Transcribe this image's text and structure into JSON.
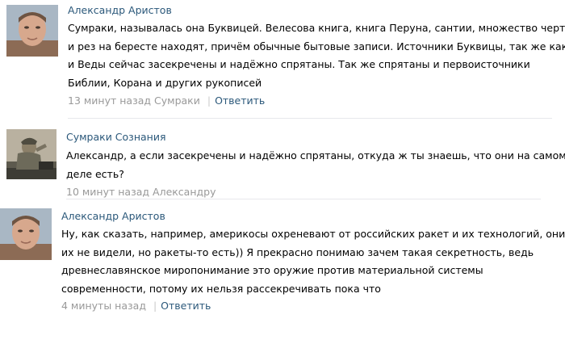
{
  "comments": [
    {
      "author": "Александр Аристов",
      "text_lines": [
        "Сумраки, называлась она Буквицей. Велесова книга, книга Перуна, сантии, множество черт",
        "и рез на бересте находят, причём обычные бытовые записи. Источники Буквицы, так же как",
        "и Веды сейчас засекречены и надёжно спрятаны. Так же спрятаны и первоисточники",
        "Библии, Корана и других рукописей"
      ],
      "time": "13 минут назад",
      "reply_to": "Сумраки",
      "separator": "|",
      "reply_label": "Ответить"
    },
    {
      "author": "Сумраки Сознания",
      "text_lines": [
        "Александр, а если засекречены и надёжно спрятаны, откуда ж ты знаешь, что они на самом",
        "деле есть?"
      ],
      "time": "10 минут назад",
      "reply_to": "Александру"
    },
    {
      "author": "Александр Аристов",
      "text_lines": [
        "Ну, как сказать, например, америкосы охреневают от российских ракет и их технологий, они",
        "их не видели, но ракеты-то есть)) Я прекрасно понимаю зачем такая секретность, ведь",
        "древнеславянское миропонимание это оружие против материальной системы",
        "современности, потому их нельзя рассекречивать пока что"
      ],
      "time": "4 минуты назад",
      "separator": "|",
      "reply_label": "Ответить"
    }
  ],
  "colors": {
    "link": "#2b587a",
    "meta": "#999999",
    "divider": "#e7e8ec"
  }
}
